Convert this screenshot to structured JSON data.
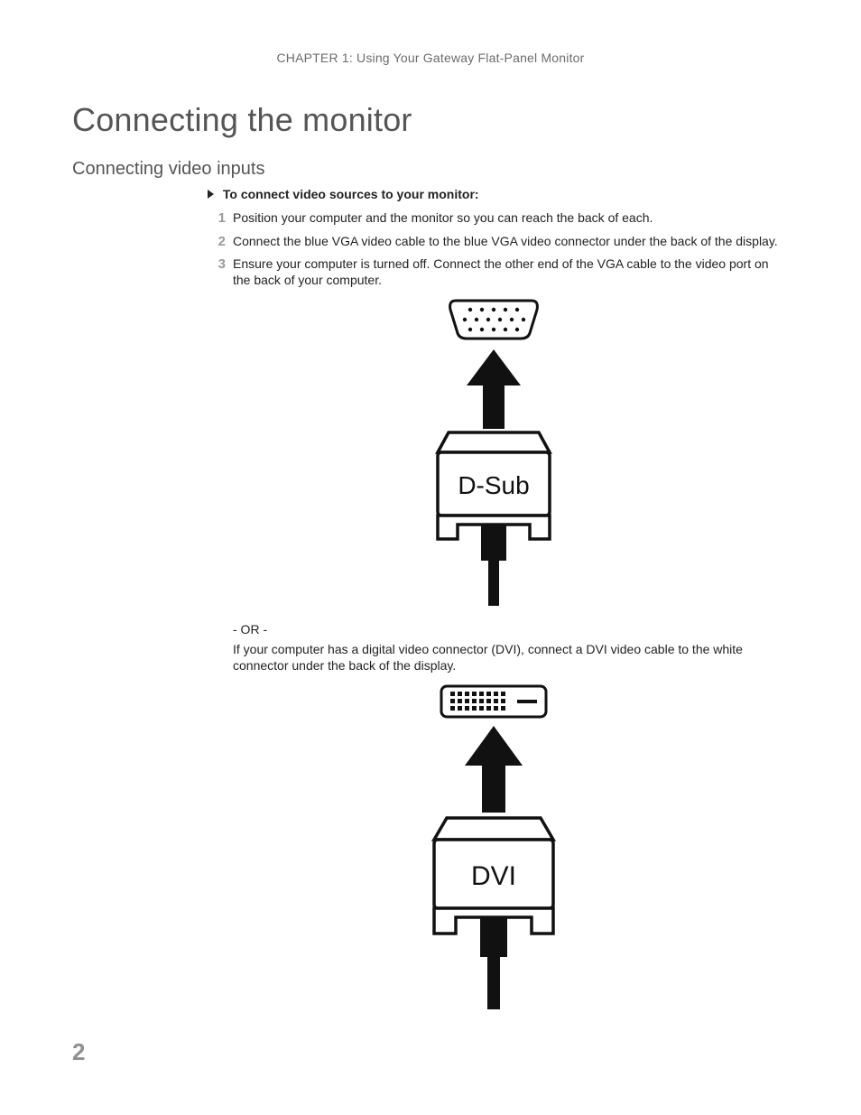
{
  "header": {
    "chapter_line": "CHAPTER 1: Using Your Gateway Flat-Panel Monitor"
  },
  "titles": {
    "section": "Connecting the monitor",
    "subsection": "Connecting video inputs"
  },
  "lead": "To connect video sources to your monitor:",
  "steps": [
    "Position your computer and the monitor so you can reach the back of each.",
    "Connect the blue VGA video cable to the blue VGA video connector under the back of the display.",
    "Ensure your computer is turned off. Connect the other end of the VGA cable to the video port on the back of your computer."
  ],
  "or_text": "- OR -",
  "dvi_para": "If your computer has a digital video connector (DVI), connect a DVI video cable to the white connector under the back of the display.",
  "diagram_labels": {
    "dsub": "D-Sub",
    "dvi": "DVI"
  },
  "page_number": "2"
}
